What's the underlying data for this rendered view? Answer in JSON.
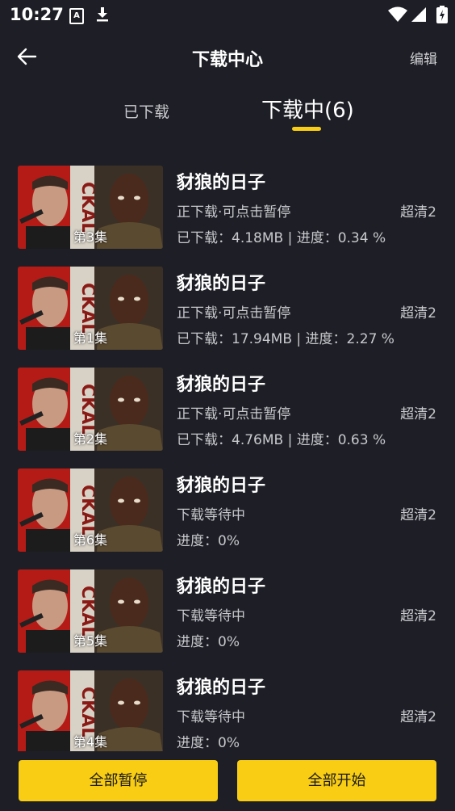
{
  "status_bar": {
    "time": "10:27",
    "icons": [
      "a-notification-icon",
      "download-icon",
      "wifi-icon",
      "signal-icon",
      "battery-icon"
    ]
  },
  "header": {
    "title": "下载中心",
    "edit_label": "编辑",
    "back_icon": "back-arrow-icon"
  },
  "tabs": [
    {
      "label": "已下载",
      "active": false
    },
    {
      "label": "下载中(6)",
      "active": true
    }
  ],
  "downloads": [
    {
      "title": "豺狼的日子",
      "episode": "第3集",
      "status": "正下载·可点击暂停",
      "quality": "超清2",
      "progress": "已下载：4.18MB | 进度：0.34 %"
    },
    {
      "title": "豺狼的日子",
      "episode": "第1集",
      "status": "正下载·可点击暂停",
      "quality": "超清2",
      "progress": "已下载：17.94MB | 进度：2.27 %"
    },
    {
      "title": "豺狼的日子",
      "episode": "第2集",
      "status": "正下载·可点击暂停",
      "quality": "超清2",
      "progress": "已下载：4.76MB | 进度：0.63 %"
    },
    {
      "title": "豺狼的日子",
      "episode": "第6集",
      "status": "下载等待中",
      "quality": "超清2",
      "progress": "进度：0%"
    },
    {
      "title": "豺狼的日子",
      "episode": "第5集",
      "status": "下载等待中",
      "quality": "超清2",
      "progress": "进度：0%"
    },
    {
      "title": "豺狼的日子",
      "episode": "第4集",
      "status": "下载等待中",
      "quality": "超清2",
      "progress": "进度：0%"
    }
  ],
  "footer": {
    "pause_all": "全部暂停",
    "start_all": "全部开始"
  },
  "colors": {
    "background": "#1e1f26",
    "accent": "#f8cd14",
    "text_secondary": "#c8c8ce"
  }
}
